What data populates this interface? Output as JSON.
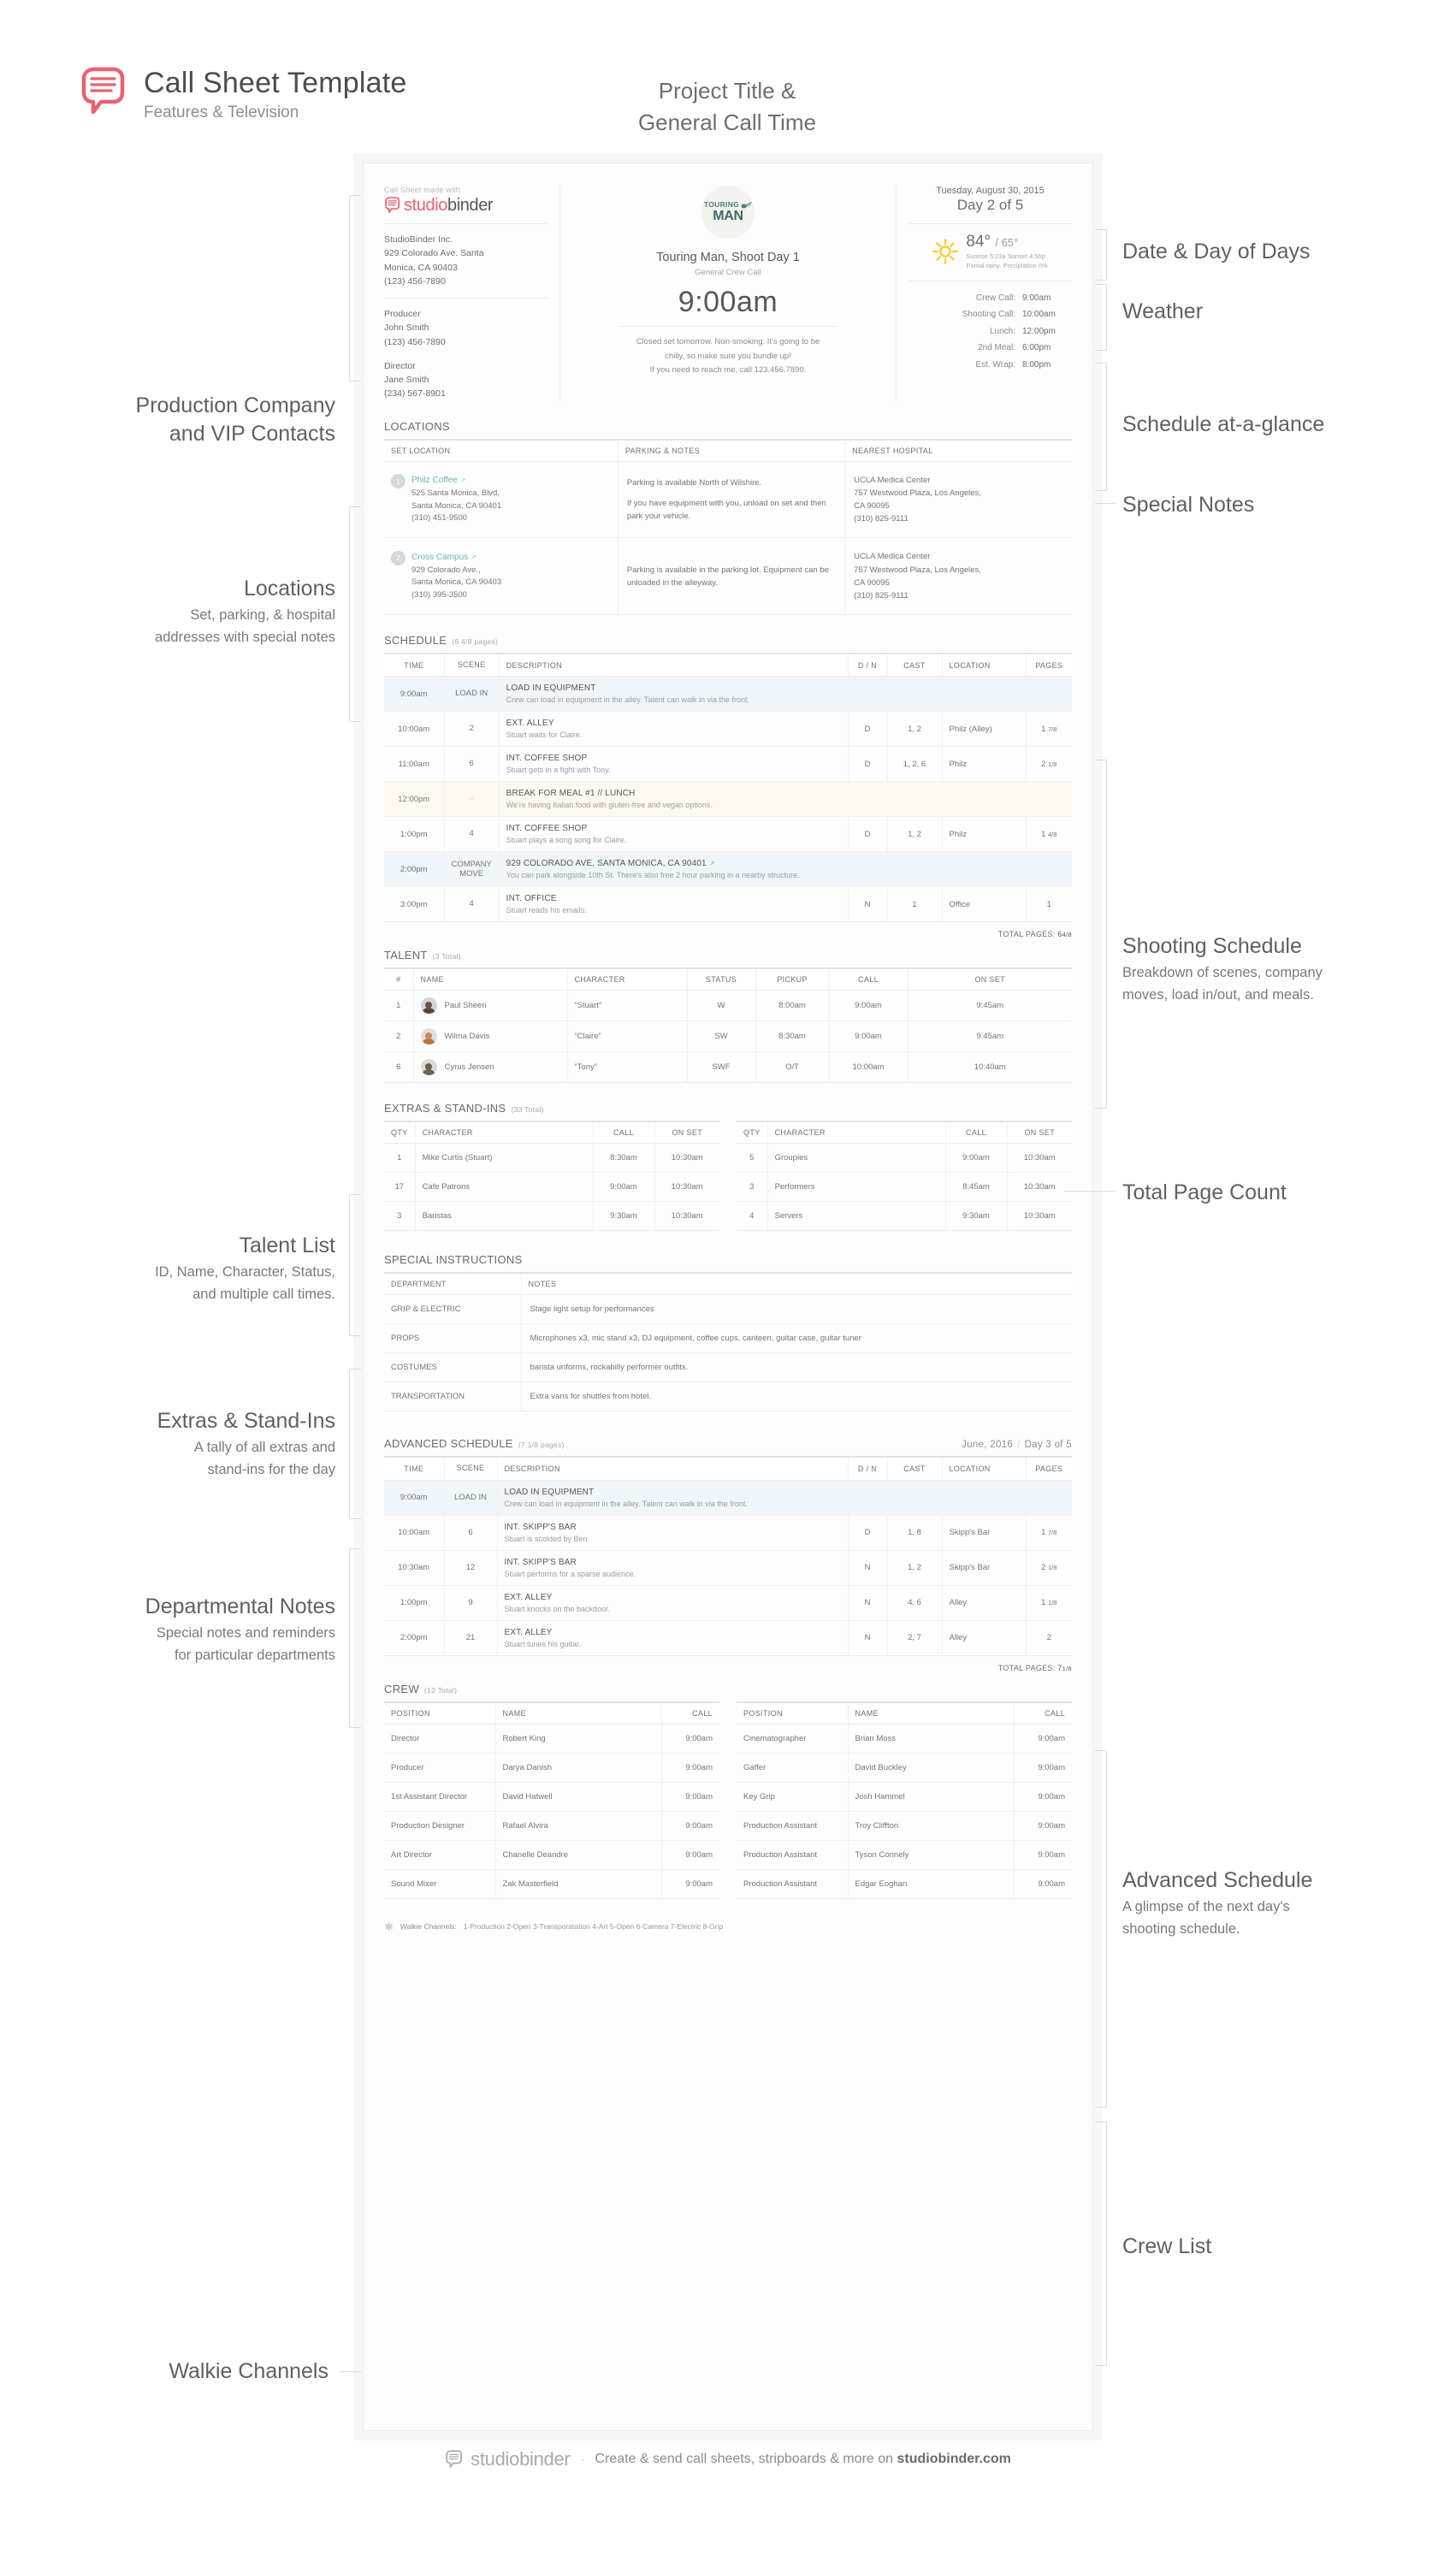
{
  "header": {
    "brand_title": "Call Sheet Template",
    "brand_subtitle": "Features & Television",
    "callout_line1": "Project Title &",
    "callout_line2": "General Call Time"
  },
  "callsheet": {
    "made_with": "Call Sheet made with",
    "brand_a": "studio",
    "brand_b": "binder",
    "company": {
      "name": "StudioBinder Inc.",
      "address1": "929 Colorado Ave. Santa",
      "address2": "Monica, CA 90403",
      "phone": "(123) 456-7890"
    },
    "contacts": [
      {
        "role": "Producer",
        "name": "John Smith",
        "phone": "(123) 456-7890"
      },
      {
        "role": "Director",
        "name": "Jane Smith",
        "phone": "(234) 567-8901"
      }
    ],
    "show_logo_top": "TOURING",
    "show_logo_big": "MAN",
    "project_title": "Touring Man, Shoot Day 1",
    "project_subtitle": "General Crew Call",
    "general_call_time": "9:00am",
    "special_notes": [
      "Closed set tomorrow. Non-smoking. It's going to be",
      "chilly, so make sure you bundle up!",
      "If you need to reach me, call 123.456.7890."
    ],
    "date": "Tuesday, August 30, 2015",
    "day_of_days": "Day 2 of 5",
    "weather": {
      "high": "84°",
      "low": "/ 65°",
      "sun": "Sunrise 5:23a  Sunset 4:55p",
      "conditions": "Partial rainy. Preciplation 0%"
    },
    "schedule_glance": [
      {
        "label": "Crew Call:",
        "value": "9:00am"
      },
      {
        "label": "Shooting Call:",
        "value": "10:00am"
      },
      {
        "label": "Lunch:",
        "value": "12:00pm"
      },
      {
        "label": "2nd Meal:",
        "value": "6:00pm"
      },
      {
        "label": "Est. Wrap:",
        "value": "8:00pm"
      }
    ]
  },
  "locations": {
    "title": "LOCATIONS",
    "columns": [
      "SET LOCATION",
      "PARKING & NOTES",
      "NEAREST HOSPITAL"
    ],
    "rows": [
      {
        "num": "1",
        "name": "Philz Coffee",
        "addr1": "525 Santa Monica, Blvd,",
        "addr2": "Santa Monica, CA 90401",
        "phone": "(310) 451-9500",
        "notes": [
          "Parking is available North of Wilshire.",
          "If you have equipment with you, unload on set and then park your vehicle."
        ],
        "hospital_name": "UCLA Medica Center",
        "hospital_addr1": "757 Westwood Plaza, Los Angeles,",
        "hospital_addr2": "CA 90095",
        "hospital_phone": "(310) 825-9111"
      },
      {
        "num": "2",
        "name": "Cross Campus",
        "addr1": "929 Colorado Ave.,",
        "addr2": "Santa Monica, CA 90403",
        "phone": "(310) 395-3500",
        "notes": [
          "Parking is available in the parking lot. Equipment can be unloaded in the alleyway."
        ],
        "hospital_name": "UCLA Medica Center",
        "hospital_addr1": "757 Westwood Plaza, Los Angeles,",
        "hospital_addr2": "CA 90095",
        "hospital_phone": "(310) 825-9111"
      }
    ]
  },
  "schedule": {
    "title": "SCHEDULE",
    "count": "(6 4/8 pages)",
    "columns": [
      "TIME",
      "SCENE",
      "DESCRIPTION",
      "D / N",
      "CAST",
      "LOCATION",
      "PAGES"
    ],
    "rows": [
      {
        "band": "blue",
        "time": "9:00am",
        "scene": "LOAD IN",
        "head": "LOAD IN EQUIPMENT",
        "sub": "Crew can load in equipment in the alley. Talent can walk in via the front.",
        "span": true
      },
      {
        "band": "",
        "time": "10:00am",
        "scene": "2",
        "head": "EXT. ALLEY",
        "sub": "Stuart waits for Claire.",
        "dn": "D",
        "cast": "1, 2",
        "location": "Philz (Alley)",
        "pages": "1",
        "frac": "7/8"
      },
      {
        "band": "",
        "time": "11:00am",
        "scene": "6",
        "head": "INT. COFFEE SHOP",
        "sub": "Stuart gets in a fight with Tony.",
        "dn": "D",
        "cast": "1, 2, 6",
        "location": "Philz",
        "pages": "2",
        "frac": "1/8"
      },
      {
        "band": "cream",
        "time": "12:00pm",
        "scene": "–",
        "head": "BREAK FOR MEAL #1 // LUNCH",
        "sub": "We're having Italian food with gluten-free and vegan options.",
        "span": true
      },
      {
        "band": "",
        "time": "1:00pm",
        "scene": "4",
        "head": "INT. COFFEE SHOP",
        "sub": "Stuart plays a song song for Claire.",
        "dn": "D",
        "cast": "1, 2",
        "location": "Philz",
        "pages": "1",
        "frac": "4/8"
      },
      {
        "band": "blue",
        "time": "2:00pm",
        "scene": "COMPANY MOVE",
        "head": "929 COLORADO AVE, SANTA MONICA, CA 90401",
        "link": true,
        "sub": "You can park alongside 10th St. There's also free 2 hour parking in a nearby structure.",
        "span": true
      },
      {
        "band": "",
        "time": "3:00pm",
        "scene": "4",
        "head": "INT. OFFICE",
        "sub": "Stuart reads his emails.",
        "dn": "N",
        "cast": "1",
        "location": "Office",
        "pages": "1",
        "frac": ""
      }
    ],
    "total_label": "TOTAL PAGES:",
    "total_value": "6",
    "total_frac": "4/8"
  },
  "talent": {
    "title": "TALENT",
    "count": "(3 Total)",
    "columns": [
      "#",
      "NAME",
      "CHARACTER",
      "STATUS",
      "PICKUP",
      "CALL",
      "ON SET"
    ],
    "rows": [
      {
        "id": "1",
        "name": "Paul Sheen",
        "character": "“Stuart”",
        "status": "W",
        "pickup": "8:00am",
        "call": "9:00am",
        "onset": "9:45am"
      },
      {
        "id": "2",
        "name": "Wilma Davis",
        "character": "“Claire”",
        "status": "SW",
        "pickup": "8:30am",
        "call": "9:00am",
        "onset": "9:45am"
      },
      {
        "id": "6",
        "name": "Cyrus Jensen",
        "character": "“Tony”",
        "status": "SWF",
        "pickup": "O/T",
        "call": "10:00am",
        "onset": "10:40am"
      }
    ]
  },
  "extras": {
    "title": "EXTRAS & STAND-INS",
    "count": "(33 Total)",
    "columns": [
      "QTY",
      "CHARACTER",
      "CALL",
      "ON SET"
    ],
    "left_rows": [
      {
        "qty": "1",
        "character": "Mike Curtis (Stuart)",
        "call": "8:30am",
        "onset": "10:30am"
      },
      {
        "qty": "17",
        "character": "Cafe Patrons",
        "call": "9:00am",
        "onset": "10:30am"
      },
      {
        "qty": "3",
        "character": "Baristas",
        "call": "9:30am",
        "onset": "10:30am"
      }
    ],
    "right_rows": [
      {
        "qty": "5",
        "character": "Groupies",
        "call": "9:00am",
        "onset": "10:30am"
      },
      {
        "qty": "3",
        "character": "Performers",
        "call": "8:45am",
        "onset": "10:30am"
      },
      {
        "qty": "4",
        "character": "Servers",
        "call": "9:30am",
        "onset": "10:30am"
      }
    ]
  },
  "special_instructions": {
    "title": "SPECIAL INSTRUCTIONS",
    "columns": [
      "DEPARTMENT",
      "NOTES"
    ],
    "rows": [
      {
        "dept": "GRIP & ELECTRIC",
        "note": "Stage light setup for performances"
      },
      {
        "dept": "PROPS",
        "note": "Microphones x3, mic stand x3, DJ equipment, coffee cups, canteen, guitar case, guitar tuner"
      },
      {
        "dept": "COSTUMES",
        "note": "barista unforms, rockabilly performer outfits."
      },
      {
        "dept": "TRANSPORTATION",
        "note": "Extra vans for shuttles from hotel."
      }
    ]
  },
  "advanced_schedule": {
    "title": "ADVANCED SCHEDULE",
    "count": "(7 1/8 pages)",
    "date": "June, 2016",
    "day_of_days": "Day 3 of 5",
    "columns": [
      "TIME",
      "SCENE",
      "DESCRIPTION",
      "D / N",
      "CAST",
      "LOCATION",
      "PAGES"
    ],
    "rows": [
      {
        "band": "blue",
        "time": "9:00am",
        "scene": "LOAD IN",
        "head": "LOAD IN EQUIPMENT",
        "sub": "Crew can load in equipment in the alley. Talent can walk in via the front.",
        "span": true
      },
      {
        "band": "",
        "time": "10:00am",
        "scene": "6",
        "head": "INT. SKIPP'S BAR",
        "sub": "Stuart is scolded by Ben",
        "dn": "D",
        "cast": "1, 8",
        "location": "Skipp's Bar",
        "pages": "1",
        "frac": "7/8"
      },
      {
        "band": "",
        "time": "10:30am",
        "scene": "12",
        "head": "INT. SKIPP'S BAR",
        "sub": "Stuart performs for a sparse audience.",
        "dn": "N",
        "cast": "1, 2",
        "location": "Skipp's Bar",
        "pages": "2",
        "frac": "1/8"
      },
      {
        "band": "",
        "time": "1:00pm",
        "scene": "9",
        "head": "EXT. ALLEY",
        "sub": "Stuart knocks on the backdoor.",
        "dn": "N",
        "cast": "4, 6",
        "location": "Alley",
        "pages": "1",
        "frac": "1/8"
      },
      {
        "band": "",
        "time": "2:00pm",
        "scene": "21",
        "head": "EXT. ALLEY",
        "sub": "Stuart tunes his guitar.",
        "dn": "N",
        "cast": "2, 7",
        "location": "Alley",
        "pages": "2",
        "frac": ""
      }
    ],
    "total_label": "TOTAL PAGES:",
    "total_value": "7",
    "total_frac": "1/8"
  },
  "crew": {
    "title": "CREW",
    "count": "(12 Total)",
    "columns": [
      "POSITION",
      "NAME",
      "CALL"
    ],
    "left_rows": [
      {
        "position": "Director",
        "name": "Robert King",
        "call": "9:00am"
      },
      {
        "position": "Producer",
        "name": "Darya Danish",
        "call": "9:00am"
      },
      {
        "position": "1st Assistant Director",
        "name": "David Hatwell",
        "call": "9:00am"
      },
      {
        "position": "Production Designer",
        "name": "Rafael Alvira",
        "call": "9:00am"
      },
      {
        "position": "Art Director",
        "name": "Chanelle Deandre",
        "call": "9:00am"
      },
      {
        "position": "Sound Mixer",
        "name": "Zak Masterfield",
        "call": "9:00am"
      }
    ],
    "right_rows": [
      {
        "position": "Cinematographer",
        "name": "Brian Moss",
        "call": "9:00am"
      },
      {
        "position": "Gaffer",
        "name": "David Buckley",
        "call": "9:00am"
      },
      {
        "position": "Key Grip",
        "name": "Josh Hammel",
        "call": "9:00am"
      },
      {
        "position": "Production Assistant",
        "name": "Troy Cliffton",
        "call": "9:00am"
      },
      {
        "position": "Production Assistant",
        "name": "Tyson Connely",
        "call": "9:00am"
      },
      {
        "position": "Production Assistant",
        "name": "Edgar Eoghan",
        "call": "9:00am"
      }
    ]
  },
  "walkie": {
    "label": "Walkie Channels:",
    "channels": "1-Production   2-Open   3-Transporatation   4-Art   5-Open   6-Camera   7-Electric   8-Grip"
  },
  "annotations": {
    "left": [
      {
        "h": "Production Company",
        "h2": "and VIP Contacts",
        "p": ""
      },
      {
        "h": "Locations",
        "p1": "Set, parking, & hospital",
        "p2": "addresses with special notes"
      },
      {
        "h": "Talent List",
        "p1": "ID, Name, Character, Status,",
        "p2": "and multiple call times."
      },
      {
        "h": "Extras & Stand-Ins",
        "p1": "A tally of all extras and",
        "p2": "stand-ins for the day"
      },
      {
        "h": "Departmental Notes",
        "p1": "Special notes and reminders",
        "p2": "for particular departments"
      },
      {
        "h": "Walkie Channels",
        "p1": "",
        "p2": ""
      }
    ],
    "right": [
      {
        "h": "Date & Day of Days"
      },
      {
        "h": "Weather"
      },
      {
        "h": "Schedule at-a-glance"
      },
      {
        "h": "Special Notes"
      },
      {
        "h": "Shooting Schedule",
        "p1": "Breakdown of scenes, company",
        "p2": "moves, load in/out, and meals."
      },
      {
        "h": "Total Page Count"
      },
      {
        "h": "Advanced Schedule",
        "p1": "A glimpse of the next day's",
        "p2": "shooting schedule."
      },
      {
        "h": "Crew List"
      }
    ]
  },
  "footer": {
    "brand_a": "studio",
    "brand_b": "binder",
    "dot": "·",
    "text_pre": "Create & send call sheets, stripboards & more on ",
    "text_bold": "studiobinder.com"
  }
}
